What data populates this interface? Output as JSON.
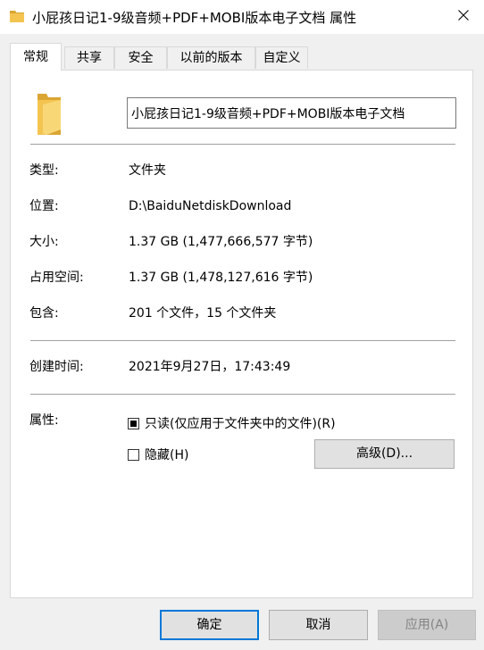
{
  "window": {
    "title": "小屁孩日记1-9级音频+PDF+MOBI版本电子文档 属性"
  },
  "tabs": [
    {
      "label": "常规"
    },
    {
      "label": "共享"
    },
    {
      "label": "安全"
    },
    {
      "label": "以前的版本"
    },
    {
      "label": "自定义"
    }
  ],
  "general": {
    "name_value": "小屁孩日记1-9级音频+PDF+MOBI版本电子文档",
    "type_label": "类型:",
    "type_value": "文件夹",
    "location_label": "位置:",
    "location_value": "D:\\BaiduNetdiskDownload",
    "size_label": "大小:",
    "size_value": "1.37 GB (1,477,666,577 字节)",
    "size_on_disk_label": "占用空间:",
    "size_on_disk_value": "1.37 GB (1,478,127,616 字节)",
    "contains_label": "包含:",
    "contains_value": "201 个文件，15 个文件夹",
    "created_label": "创建时间:",
    "created_value": "2021年9月27日，17:43:49",
    "attributes_label": "属性:",
    "readonly_label": "只读(仅应用于文件夹中的文件)(R)",
    "readonly_state": "indeterminate",
    "hidden_label": "隐藏(H)",
    "hidden_checked": false,
    "advanced_label": "高级(D)..."
  },
  "footer": {
    "ok_label": "确定",
    "cancel_label": "取消",
    "apply_label": "应用(A)"
  },
  "colors": {
    "folder": "#f4c451",
    "folder_dark": "#dba532",
    "accent": "#0078d7"
  }
}
